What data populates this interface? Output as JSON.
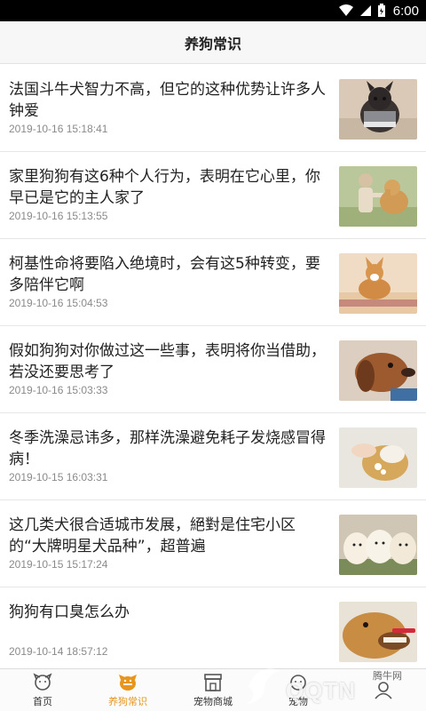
{
  "status_bar": {
    "time": "6:00"
  },
  "header": {
    "title": "养狗常识"
  },
  "articles": [
    {
      "title": "法国斗牛犬智力不高，但它的这种优势让许多人钟爱",
      "date": "2019-10-16 15:18:41",
      "thumb_icon": "french-bulldog-photo"
    },
    {
      "title": "家里狗狗有这6种个人行为，表明在它心里，你早已是它的主人家了",
      "date": "2019-10-16 15:13:55",
      "thumb_icon": "dog-high-five-photo"
    },
    {
      "title": "柯基性命将要陷入绝境时，会有这5种转变，要多陪伴它啊",
      "date": "2019-10-16 15:04:53",
      "thumb_icon": "corgi-photo"
    },
    {
      "title": "假如狗狗对你做过这一些事，表明将你当借助，若没还要思考了",
      "date": "2019-10-16 15:03:33",
      "thumb_icon": "dachshund-photo"
    },
    {
      "title": "冬季洗澡忌讳多，那样洗澡避免耗子发烧感冒得病！",
      "date": "2019-10-15 16:03:31",
      "thumb_icon": "dog-bath-photo"
    },
    {
      "title": "这几类犬很合适城市发展，絕對是住宅小区的“大牌明星犬品种”，超普遍",
      "date": "2019-10-15 15:17:24",
      "thumb_icon": "puppies-photo"
    },
    {
      "title": "狗狗有口臭怎么办",
      "date": "2019-10-14 18:57:12",
      "thumb_icon": "dog-toothbrush-photo"
    }
  ],
  "tabs": [
    {
      "label": "首页",
      "icon": "home-dog-icon",
      "active": false
    },
    {
      "label": "养狗常识",
      "icon": "dog-knowledge-icon",
      "active": true
    },
    {
      "label": "宠物商城",
      "icon": "shop-icon",
      "active": false
    },
    {
      "label": "宠物",
      "icon": "pet-icon",
      "active": false
    },
    {
      "label": "",
      "icon": "profile-icon",
      "active": false
    }
  ],
  "watermark": {
    "brand": "QQTN",
    "site": "腾牛网"
  },
  "colors": {
    "accent": "#e8951d",
    "header_bg": "#f7f7f7",
    "date_text": "#8a8a8a"
  }
}
